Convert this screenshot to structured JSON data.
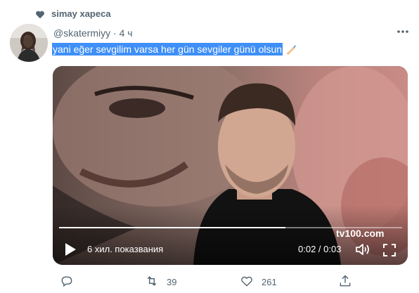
{
  "liked_by": {
    "name": "simay xapeca"
  },
  "tweet": {
    "handle": "@skatermiyy",
    "separator": "·",
    "age": "4 ч",
    "text": "yani eğer sevgilim varsa her gün sevgiler günü olsun",
    "emoji": "writing-hand-icon"
  },
  "video": {
    "views_label": "6 хил. показвания",
    "time_label": "0:02 / 0:03",
    "progress": 0.66,
    "watermark": "tv100.com"
  },
  "actions": {
    "retweets": "39",
    "likes": "261"
  },
  "colors": {
    "selection": "#3f8ff7",
    "muted": "#536471",
    "text": "#0f1419"
  }
}
